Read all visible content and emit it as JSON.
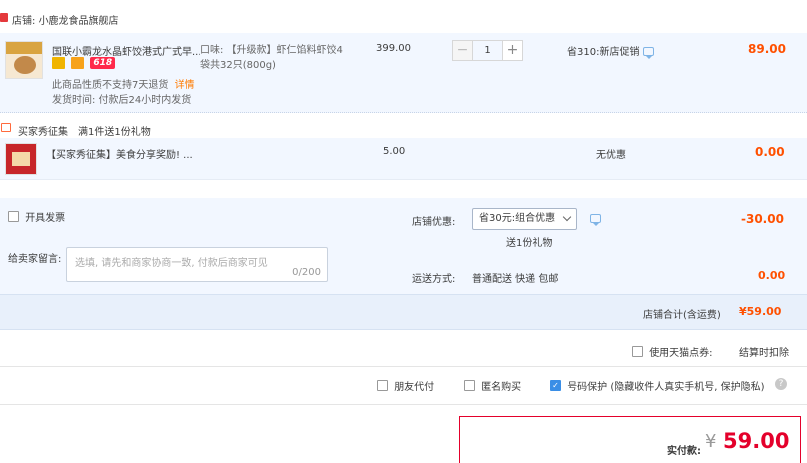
{
  "shop": {
    "label": "店铺:",
    "name": "小鹿龙食品旗舰店",
    "icon": "shop-icon"
  },
  "item": {
    "title": "国联小霸龙水晶虾饺港式广式早...",
    "badge_618": "618",
    "no_return": "此商品性质不支持7天退货",
    "detail_link": "详情",
    "ship_time": "发货时间: 付款后24小时内发货",
    "spec_line1": "口味: 【升级款】虾仁馅料虾饺4",
    "spec_line2": "袋共32只(800g)",
    "price": "399.00",
    "quantity": "1",
    "minus": "−",
    "plus": "+",
    "promo": "省310:新店促销",
    "subtotal": "89.00"
  },
  "gift_section": {
    "tag": "买家秀征集",
    "rule": "满1件送1份礼物"
  },
  "gift_item": {
    "title": "【买家秀征集】美食分享奖励! ...",
    "price": "5.00",
    "promo": "无优惠",
    "subtotal": "0.00"
  },
  "invoice": {
    "label": "开具发票"
  },
  "message": {
    "label": "给卖家留言:",
    "placeholder": "选填, 请先和商家协商一致, 付款后商家可见",
    "count": "0/200"
  },
  "shop_discount": {
    "label": "店铺优惠:",
    "selected": "省30元:组合优惠",
    "gift_note": "送1份礼物",
    "amount": "-30.00"
  },
  "shipping": {
    "label": "运送方式:",
    "method": "普通配送 快递 包邮",
    "amount": "0.00"
  },
  "shop_total": {
    "label": "店铺合计(含运费)",
    "amount": "¥59.00"
  },
  "points": {
    "label": "使用天猫点券:",
    "note": "结算时扣除"
  },
  "options": {
    "friend_pay": "朋友代付",
    "anonymous": "匿名购买",
    "number_protect": "号码保护 (隐藏收件人真实手机号, 保护隐私)",
    "help": "?"
  },
  "payment": {
    "label": "实付款:",
    "currency": "¥",
    "amount": "59.00"
  },
  "colors": {
    "accent": "#ff5000",
    "pay_red": "#e4002b",
    "row_blue": "#f2f7ff"
  }
}
